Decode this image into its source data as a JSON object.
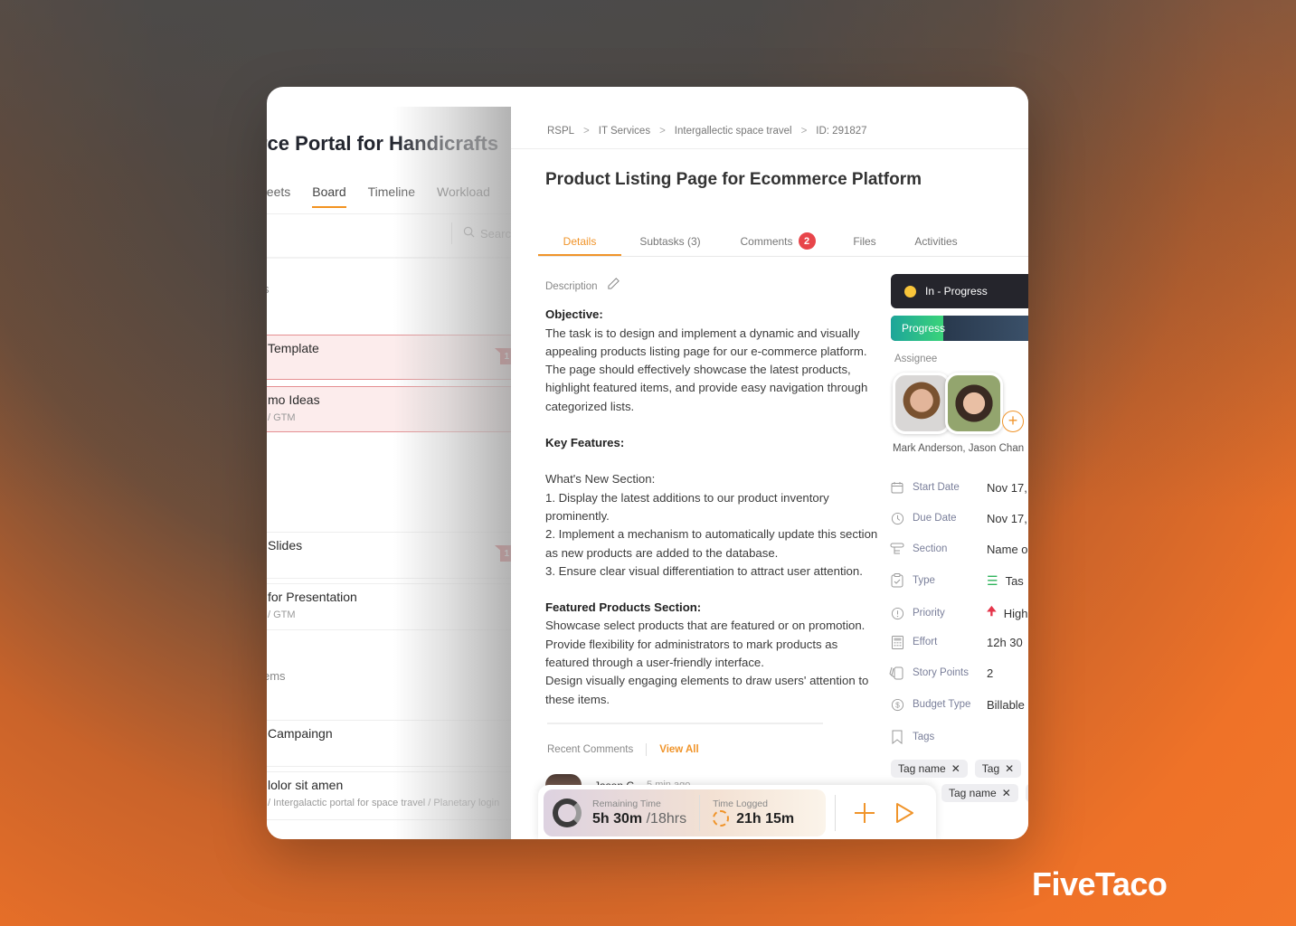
{
  "brand": {
    "name": "FiveTaco"
  },
  "board": {
    "project_title": "rce Portal for Handicrafts",
    "tabs": [
      {
        "label": "heets",
        "active": false
      },
      {
        "label": "Board",
        "active": true
      },
      {
        "label": "Timeline",
        "active": false
      },
      {
        "label": "Workload",
        "active": false
      }
    ],
    "search_placeholder": "Searc",
    "group_labels": [
      "s",
      "ems"
    ],
    "tasks": [
      {
        "title": "Template",
        "subtitle": "",
        "flagged": true,
        "badge": "1"
      },
      {
        "title": "mo Ideas",
        "subtitle": "/ GTM",
        "flagged": true,
        "badge": ""
      },
      {
        "title": "Slides",
        "subtitle": "",
        "flagged": false,
        "badge": "1"
      },
      {
        "title": "for Presentation",
        "subtitle": "/ GTM",
        "flagged": false,
        "badge": ""
      },
      {
        "title": "Campaingn",
        "subtitle": "",
        "flagged": false,
        "badge": ""
      },
      {
        "title": "lolor sit amen",
        "subtitle": "/ Intergalactic portal for space travel / Planetary login",
        "flagged": false,
        "badge": ""
      }
    ]
  },
  "detail": {
    "breadcrumb": [
      "RSPL",
      "IT Services",
      "Intergallectic space travel",
      "ID: 291827"
    ],
    "title": "Product Listing Page for Ecommerce Platform",
    "tabs": [
      {
        "label": "Details",
        "active": true,
        "badge": ""
      },
      {
        "label": "Subtasks (3)",
        "active": false,
        "badge": ""
      },
      {
        "label": "Comments",
        "active": false,
        "badge": "2"
      },
      {
        "label": "Files",
        "active": false,
        "badge": ""
      },
      {
        "label": "Activities",
        "active": false,
        "badge": ""
      }
    ],
    "description": {
      "label": "Description",
      "objective_heading": "Objective:",
      "objective_text": "The task is to design and implement a dynamic and visually appealing products listing page for our e-commerce platform. The page should effectively showcase the latest products, highlight featured items, and provide easy navigation through categorized lists.",
      "key_features_heading": "Key Features:",
      "whats_new_heading": "What's New Section:",
      "whats_new_items": [
        "1. Display the latest additions to our product inventory prominently.",
        "2. Implement a mechanism to automatically update this section as new products are added to the database.",
        "3. Ensure clear visual differentiation to attract user attention."
      ],
      "featured_heading": "Featured Products Section:",
      "featured_items": [
        "Showcase select products that are featured or on promotion.",
        "Provide flexibility for administrators to mark products as featured through a user-friendly interface.",
        "Design visually engaging elements to draw users' attention to these items."
      ]
    },
    "comments": {
      "label": "Recent Comments",
      "view_all": "View All",
      "latest": {
        "author": "Jason C",
        "time": "5 min ago"
      }
    },
    "timer": {
      "remaining_label": "Remaining Time",
      "remaining_value": "5h 30m",
      "remaining_total": "/18hrs",
      "logged_label": "Time Logged",
      "logged_value": "21h 15m",
      "add_icon": "plus-icon",
      "play_icon": "play-icon"
    },
    "sidebar": {
      "status": "In - Progress",
      "status_color": "#f9c53a",
      "progress_label": "Progress",
      "progress_fraction": 0.36,
      "assignee_label": "Assignee",
      "assignee_names": "Mark Anderson, Jason Chan",
      "properties": [
        {
          "icon": "calendar-icon",
          "label": "Start Date",
          "value": "Nov 17,"
        },
        {
          "icon": "clock-icon",
          "label": "Due Date",
          "value": "Nov 17,"
        },
        {
          "icon": "section-icon",
          "label": "Section",
          "value": "Name o"
        },
        {
          "icon": "clipboard-icon",
          "label": "Type",
          "value": "Tas"
        },
        {
          "icon": "info-icon",
          "label": "Priority",
          "value": "High"
        },
        {
          "icon": "calculator-icon",
          "label": "Effort",
          "value": "12h 30"
        },
        {
          "icon": "cards-icon",
          "label": "Story Points",
          "value": "2"
        },
        {
          "icon": "dollar-icon",
          "label": "Budget Type",
          "value": "Billable"
        },
        {
          "icon": "bookmark-icon",
          "label": "Tags",
          "value": ""
        }
      ],
      "tags_row1": [
        "Tag name",
        "Tag",
        "T"
      ],
      "tags_row2": [
        "Tag name",
        "T"
      ]
    }
  }
}
